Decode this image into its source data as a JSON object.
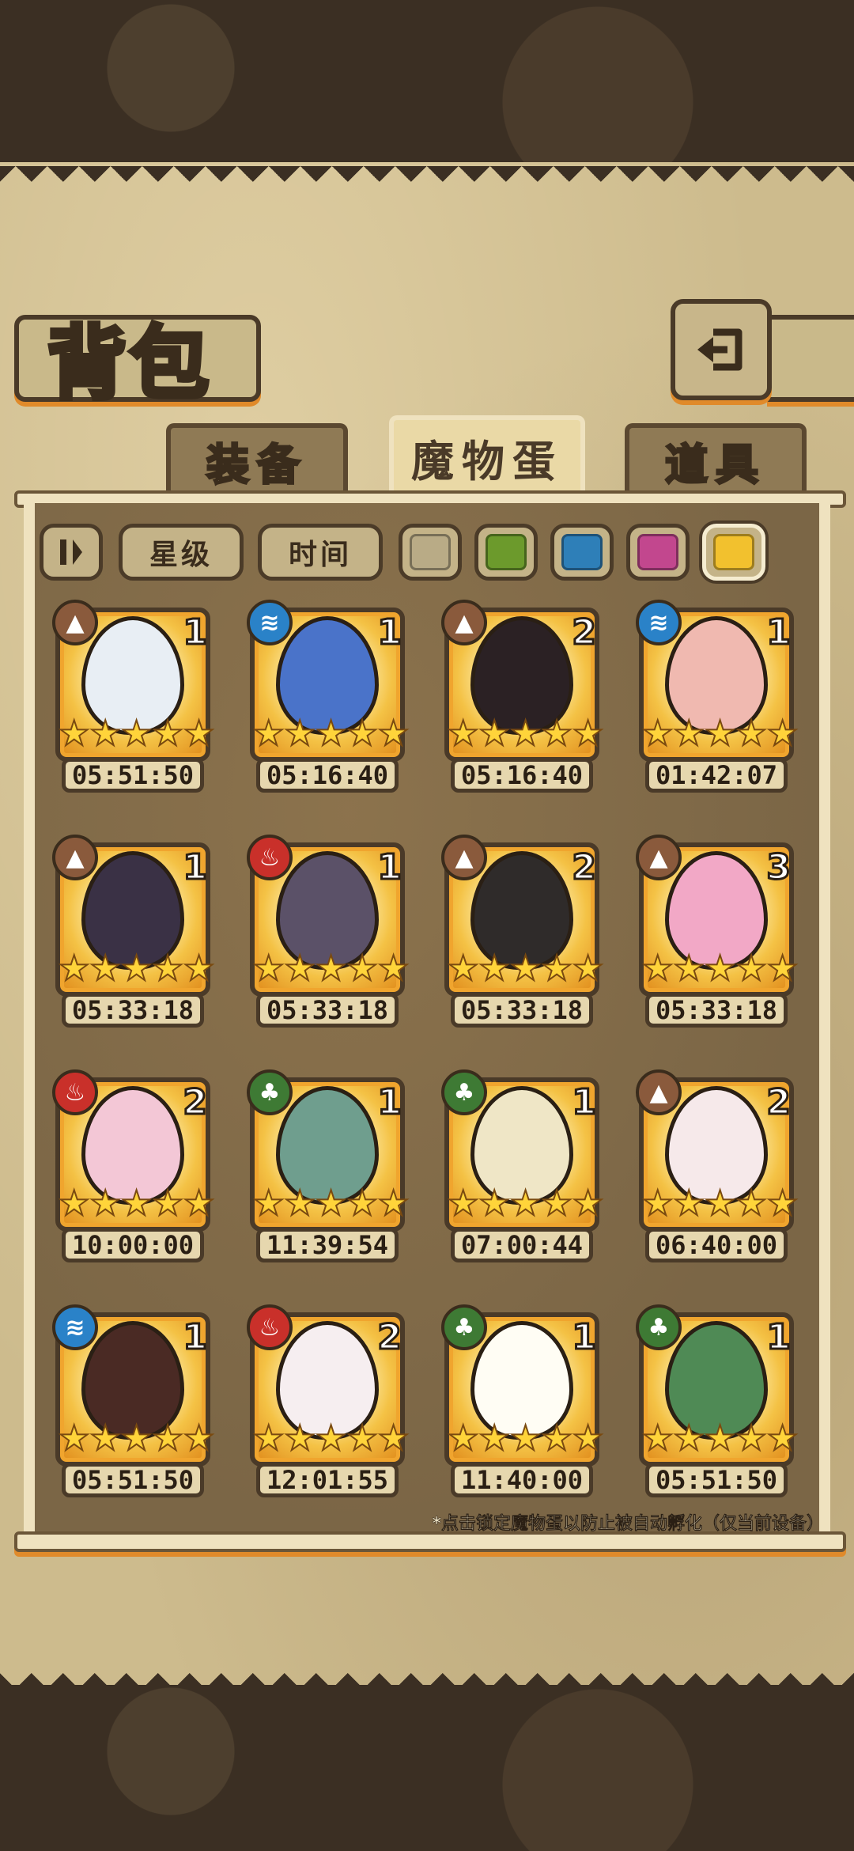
{
  "title": "背包",
  "tabs": [
    {
      "label": "装备",
      "active": false
    },
    {
      "label": "魔物蛋",
      "active": true
    },
    {
      "label": "道具",
      "active": false
    }
  ],
  "filters": {
    "sort_icon": "sort-toggle-icon",
    "star_label": "星级",
    "time_label": "时间",
    "swatches": [
      {
        "name": "grey",
        "color": "#b9ab86",
        "selected": false
      },
      {
        "name": "green",
        "color": "#6c9a2c",
        "selected": false
      },
      {
        "name": "blue",
        "color": "#2e7fb8",
        "selected": false
      },
      {
        "name": "pink",
        "color": "#c2478e",
        "selected": false
      },
      {
        "name": "gold",
        "color": "#f2c12e",
        "selected": true
      }
    ]
  },
  "eggs": [
    {
      "element": "earth",
      "count": "1",
      "stars": 5,
      "timer": "05:51:50",
      "egg_color": "#e8eef4"
    },
    {
      "element": "water",
      "count": "1",
      "stars": 5,
      "timer": "05:16:40",
      "egg_color": "#4a73c9"
    },
    {
      "element": "earth",
      "count": "2",
      "stars": 5,
      "timer": "05:16:40",
      "egg_color": "#2b2124"
    },
    {
      "element": "water",
      "count": "1",
      "stars": 5,
      "timer": "01:42:07",
      "egg_color": "#f0b9b0"
    },
    {
      "element": "earth",
      "count": "1",
      "stars": 5,
      "timer": "05:33:18",
      "egg_color": "#3a3145"
    },
    {
      "element": "fire",
      "count": "1",
      "stars": 5,
      "timer": "05:33:18",
      "egg_color": "#5b5168"
    },
    {
      "element": "earth",
      "count": "2",
      "stars": 5,
      "timer": "05:33:18",
      "egg_color": "#2f2b2a"
    },
    {
      "element": "earth",
      "count": "3",
      "stars": 5,
      "timer": "05:33:18",
      "egg_color": "#f2a8c6"
    },
    {
      "element": "fire",
      "count": "2",
      "stars": 5,
      "timer": "10:00:00",
      "egg_color": "#f3c7d6"
    },
    {
      "element": "wood",
      "count": "1",
      "stars": 5,
      "timer": "11:39:54",
      "egg_color": "#6f9e8e"
    },
    {
      "element": "wood",
      "count": "1",
      "stars": 5,
      "timer": "07:00:44",
      "egg_color": "#efe6c6"
    },
    {
      "element": "earth",
      "count": "2",
      "stars": 5,
      "timer": "06:40:00",
      "egg_color": "#f6e9ea"
    },
    {
      "element": "water",
      "count": "1",
      "stars": 5,
      "timer": "05:51:50",
      "egg_color": "#4a2a24"
    },
    {
      "element": "fire",
      "count": "2",
      "stars": 5,
      "timer": "12:01:55",
      "egg_color": "#f6eef0"
    },
    {
      "element": "wood",
      "count": "1",
      "stars": 5,
      "timer": "11:40:00",
      "egg_color": "#fffdf4"
    },
    {
      "element": "wood",
      "count": "1",
      "stars": 5,
      "timer": "05:51:50",
      "egg_color": "#4f8a55"
    }
  ],
  "elements": {
    "earth": {
      "color": "#8a5a3c",
      "glyph": "▲",
      "icon": "earth-element-icon"
    },
    "water": {
      "color": "#2a82c8",
      "glyph": "≋",
      "icon": "water-element-icon"
    },
    "fire": {
      "color": "#c9302a",
      "glyph": "♨",
      "icon": "fire-element-icon"
    },
    "wood": {
      "color": "#3e7a34",
      "glyph": "♣",
      "icon": "leaf-element-icon"
    }
  },
  "footer_note": "*点击锁定魔物蛋以防止被自动孵化（仅当前设备）"
}
